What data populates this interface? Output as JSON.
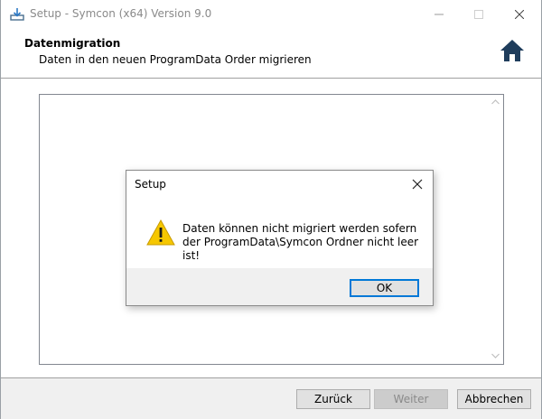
{
  "window": {
    "title": "Setup - Symcon (x64) Version 9.0"
  },
  "header": {
    "title": "Datenmigration",
    "subtitle": "Daten in den neuen ProgramData Order migrieren"
  },
  "footer": {
    "back_label": "Zurück",
    "next_label": "Weiter",
    "cancel_label": "Abbrechen"
  },
  "dialog": {
    "title": "Setup",
    "message": "Daten können nicht migriert werden sofern der ProgramData\\Symcon Ordner nicht leer ist!",
    "ok_label": "OK",
    "icon": "warning-icon"
  },
  "icons": {
    "app": "setup-install-icon",
    "home": "home-icon",
    "minimize": "minimize-icon",
    "maximize": "maximize-icon",
    "close": "close-icon"
  },
  "colors": {
    "accent": "#0078d7",
    "home_icon": "#1f3d5c",
    "warning": "#f6c700"
  }
}
